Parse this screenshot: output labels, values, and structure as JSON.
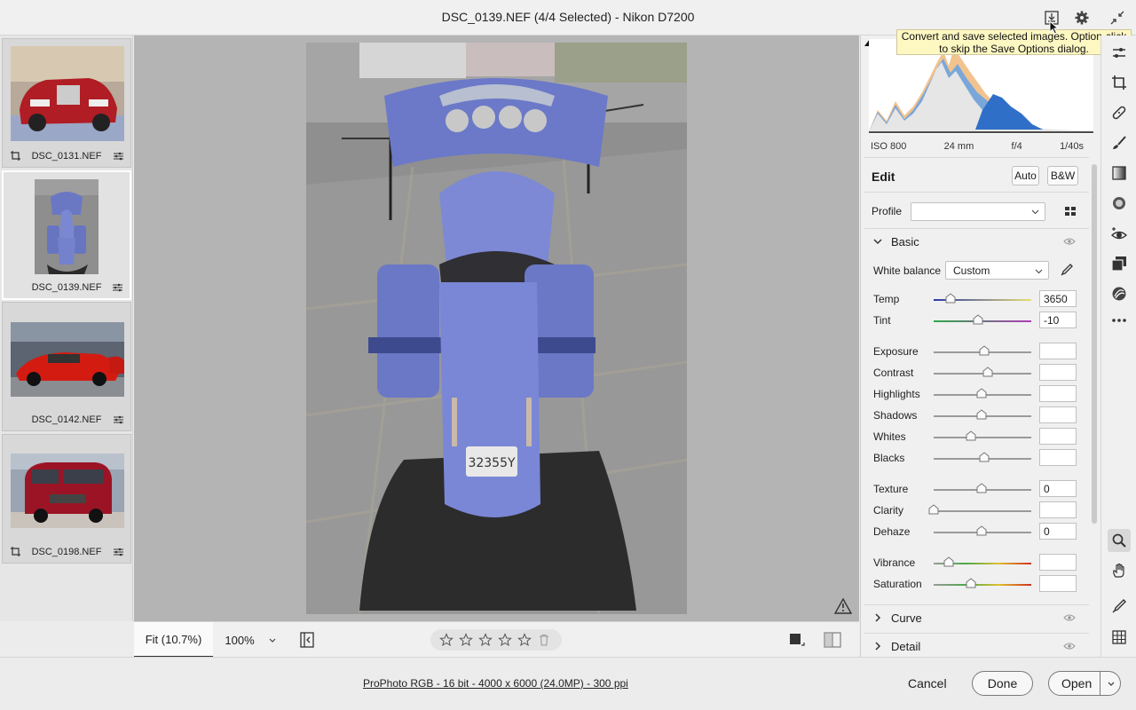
{
  "window": {
    "title": "DSC_0139.NEF (4/4 Selected)  -  Nikon D7200"
  },
  "titlebar_icons": [
    "save-image-icon",
    "gear-icon",
    "collapse-icon"
  ],
  "tooltip": {
    "line1": "Convert and save selected images. Option-click",
    "line2": "to skip the Save Options dialog."
  },
  "filmstrip": {
    "items": [
      {
        "name": "DSC_0131.NEF",
        "selected": false,
        "subject": "red luxury SUV"
      },
      {
        "name": "DSC_0139.NEF",
        "selected": true,
        "subject": "blue motorcycle"
      },
      {
        "name": "DSC_0142.NEF",
        "selected": false,
        "subject": "red sports car"
      },
      {
        "name": "DSC_0198.NEF",
        "selected": false,
        "subject": "red van"
      }
    ]
  },
  "photo": {
    "plate": "32355Y"
  },
  "bottombar": {
    "zoom_fit": "Fit (10.7%)",
    "zoom_100": "100%",
    "stars": 0
  },
  "histogram": {
    "iso": "ISO 800",
    "focal": "24 mm",
    "aperture": "f/4",
    "shutter": "1/40s"
  },
  "edit": {
    "title": "Edit",
    "auto_label": "Auto",
    "bw_label": "B&W",
    "profile_label": "Profile",
    "profile_value": ""
  },
  "basic": {
    "label": "Basic",
    "wb_label": "White balance",
    "wb_value": "Custom",
    "sliders": [
      {
        "label": "Temp",
        "value": "3650",
        "pos": 0.17
      },
      {
        "label": "Tint",
        "value": "-10",
        "pos": 0.45
      },
      {
        "label": "Exposure",
        "value": "",
        "pos": 0.52
      },
      {
        "label": "Contrast",
        "value": "",
        "pos": 0.55
      },
      {
        "label": "Highlights",
        "value": "",
        "pos": 0.49
      },
      {
        "label": "Shadows",
        "value": "",
        "pos": 0.49
      },
      {
        "label": "Whites",
        "value": "",
        "pos": 0.38
      },
      {
        "label": "Blacks",
        "value": "",
        "pos": 0.52
      },
      {
        "label": "Texture",
        "value": "0",
        "pos": 0.49
      },
      {
        "label": "Clarity",
        "value": "",
        "pos": 0.0
      },
      {
        "label": "Dehaze",
        "value": "0",
        "pos": 0.49
      },
      {
        "label": "Vibrance",
        "value": "",
        "pos": 0.15
      },
      {
        "label": "Saturation",
        "value": "",
        "pos": 0.38
      }
    ]
  },
  "sections": [
    {
      "label": "Curve"
    },
    {
      "label": "Detail"
    }
  ],
  "tools": [
    "edit-sliders-icon",
    "crop-icon",
    "healing-icon",
    "brush-icon",
    "linear-gradient-icon",
    "radial-filter-icon",
    "red-eye-icon",
    "snapshots-icon",
    "presets-icon",
    "more-icon",
    "zoom-icon",
    "hand-icon",
    "color-sampler-icon",
    "grid-icon"
  ],
  "footer": {
    "info": "ProPhoto RGB - 16 bit - 4000 x 6000 (24.0MP) - 300 ppi",
    "cancel": "Cancel",
    "done": "Done",
    "open": "Open"
  },
  "colors": {
    "accent": "#1473e6",
    "panel_bg": "#f0f0f0",
    "canvas_bg": "#b4b4b4"
  }
}
